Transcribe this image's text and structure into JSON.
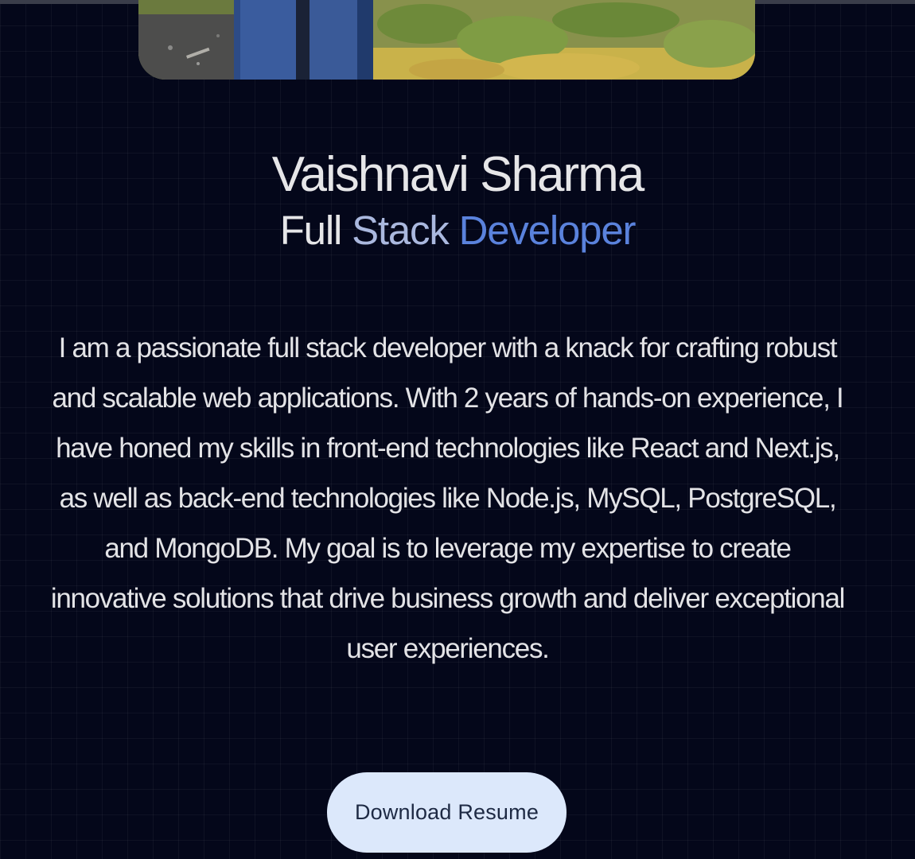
{
  "profile": {
    "name": "Vaishnavi Sharma",
    "role_word_1": "Full",
    "role_word_2": "Stack",
    "role_word_3": "Developer",
    "bio": "I am a passionate full stack developer with a knack for crafting robust and scalable web applications. With 2 years of hands-on experience, I have honed my skills in front-end technologies like React and Next.js, as well as back-end technologies like Node.js, MySQL, PostgreSQL, and MongoDB. My goal is to leverage my expertise to create innovative solutions that drive business growth and deliver exceptional user experiences."
  },
  "actions": {
    "download_resume_label": "Download Resume"
  },
  "colors": {
    "background": "#04071a",
    "name_text": "#e6e6e8",
    "role_stack": "#aab8de",
    "role_developer": "#5a82dc",
    "button_bg": "#dce8fb",
    "button_text": "#1e2a44"
  }
}
